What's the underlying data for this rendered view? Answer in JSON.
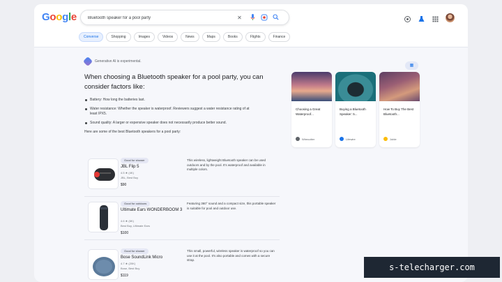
{
  "header": {
    "logo": [
      "G",
      "o",
      "o",
      "g",
      "l",
      "e"
    ],
    "logo_colors": [
      "#4285f4",
      "#ea4335",
      "#fbbc05",
      "#4285f4",
      "#34a853",
      "#ea4335"
    ],
    "search_value": "Bluetooth speaker for a pool party",
    "clear_icon": "close-icon",
    "mic_icon": "mic-icon",
    "lens_icon": "lens-icon",
    "search_icon": "search-icon"
  },
  "tabs": [
    "Converse",
    "Shopping",
    "Images",
    "Videos",
    "News",
    "Maps",
    "Books",
    "Flights",
    "Finance"
  ],
  "sge": {
    "label": "Generative AI is experimental.",
    "title": "When choosing a Bluetooth speaker for a pool party, you can consider factors like:",
    "bullets": [
      "Battery: How long the batteries last.",
      "Water resistance: Whether the speaker is waterproof. Reviewers suggest a water resistance rating of at least IPX5.",
      "Sound quality: A larger or expensive speaker does not necessarily produce better sound."
    ],
    "intro": "Here are some of the best Bluetooth speakers for a pool party:"
  },
  "products": [
    {
      "badge": "Good for shower",
      "name": "JBL Flip 5",
      "rating": "4.5 ★ (4K)",
      "seller": "JBL, Best Buy",
      "price": "$90",
      "description": "This wireless, lightweight Bluetooth speaker can be used outdoors and by the pool. It's waterproof and available in multiple colors."
    },
    {
      "badge": "Good for outdoors",
      "name": "Ultimate Ears WONDERBOOM 3",
      "rating": "4.6 ★ (6K)",
      "seller": "Best Buy, Ultimate Ears",
      "price": "$100",
      "description": "Featuring 360° sound and a compact size, this portable speaker is suitable for pool and outdoor use."
    },
    {
      "badge": "Good for shower",
      "name": "Bose SoundLink Micro",
      "rating": "4.7 ★ (20K)",
      "seller": "Bose, Best Buy",
      "price": "$119",
      "description": "This small, powerful, wireless speaker is waterproof so you can use it at the pool. It's also portable and comes with a secure strap."
    }
  ],
  "sources": [
    {
      "title": "Choosing a Great Waterproof...",
      "site": "Wirecutter",
      "colors": [
        "#6a4a73",
        "#e8a98c"
      ],
      "dot": "#5f6368"
    },
    {
      "title": "Buying a Bluetooth Speaker: 5...",
      "site": "Lifewire",
      "colors": [
        "#1b6f7a",
        "#4fa7a8"
      ],
      "dot": "#1a73e8"
    },
    {
      "title": "How To Buy The Best Bluetooth...",
      "site": "Joble",
      "colors": [
        "#6b4a6e",
        "#c77a7a"
      ],
      "dot": "#fbbc05"
    }
  ],
  "watermark": "s-telecharger.com"
}
